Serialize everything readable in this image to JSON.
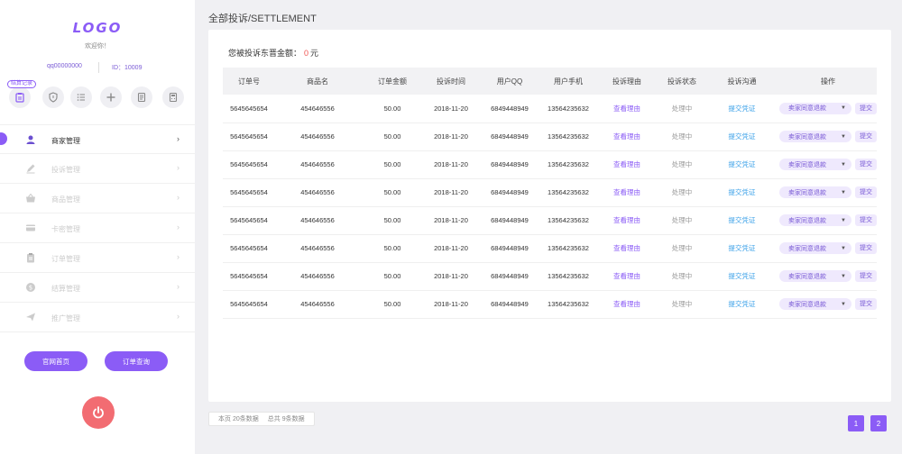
{
  "sidebar": {
    "logo": "LOGO",
    "welcome": "欢迎你！",
    "account_qq": "qq00000000",
    "account_id": "ID：10009",
    "quick_badge": "结算记录",
    "quick_icons": [
      "clipboard-icon",
      "shield-icon",
      "list-icon",
      "plus-icon",
      "document-icon",
      "calculator-icon"
    ],
    "nav": [
      {
        "label": "商家管理",
        "icon": "user-icon",
        "active": true
      },
      {
        "label": "投诉管理",
        "icon": "pencil-icon",
        "active": false
      },
      {
        "label": "商品管理",
        "icon": "basket-icon",
        "active": false
      },
      {
        "label": "卡密管理",
        "icon": "card-icon",
        "active": false
      },
      {
        "label": "订单管理",
        "icon": "clipboard-icon",
        "active": false
      },
      {
        "label": "结算管理",
        "icon": "coin-icon",
        "active": false
      },
      {
        "label": "推广管理",
        "icon": "paper-plane-icon",
        "active": false
      }
    ],
    "home_button": "官网首页",
    "order_query_button": "订单查询"
  },
  "breadcrumb": "全部投诉/SETTLEMENT",
  "summary": {
    "label": "您被投诉东晋金额：",
    "amount": "0",
    "unit": "元"
  },
  "table": {
    "columns": [
      "订单号",
      "商品名",
      "订单金额",
      "投诉时间",
      "用户QQ",
      "用户手机",
      "投诉理由",
      "投诉状态",
      "投诉沟通",
      "操作"
    ],
    "rows": [
      {
        "order_no": "5645645654",
        "product": "454646556",
        "amount": "50.00",
        "time": "2018-11-20",
        "qq": "6849448949",
        "phone": "13564235632",
        "reason": "查看理由",
        "status": "处理中",
        "comm": "提交凭证",
        "action": "卖家同意退款",
        "submit": "提交"
      },
      {
        "order_no": "5645645654",
        "product": "454646556",
        "amount": "50.00",
        "time": "2018-11-20",
        "qq": "6849448949",
        "phone": "13564235632",
        "reason": "查看理由",
        "status": "处理中",
        "comm": "提交凭证",
        "action": "卖家同意退款",
        "submit": "提交"
      },
      {
        "order_no": "5645645654",
        "product": "454646556",
        "amount": "50.00",
        "time": "2018-11-20",
        "qq": "6849448949",
        "phone": "13564235632",
        "reason": "查看理由",
        "status": "处理中",
        "comm": "提交凭证",
        "action": "卖家同意退款",
        "submit": "提交"
      },
      {
        "order_no": "5645645654",
        "product": "454646556",
        "amount": "50.00",
        "time": "2018-11-20",
        "qq": "6849448949",
        "phone": "13564235632",
        "reason": "查看理由",
        "status": "处理中",
        "comm": "提交凭证",
        "action": "卖家同意退款",
        "submit": "提交"
      },
      {
        "order_no": "5645645654",
        "product": "454646556",
        "amount": "50.00",
        "time": "2018-11-20",
        "qq": "6849448949",
        "phone": "13564235632",
        "reason": "查看理由",
        "status": "处理中",
        "comm": "提交凭证",
        "action": "卖家同意退款",
        "submit": "提交"
      },
      {
        "order_no": "5645645654",
        "product": "454646556",
        "amount": "50.00",
        "time": "2018-11-20",
        "qq": "6849448949",
        "phone": "13564235632",
        "reason": "查看理由",
        "status": "处理中",
        "comm": "提交凭证",
        "action": "卖家同意退款",
        "submit": "提交"
      },
      {
        "order_no": "5645645654",
        "product": "454646556",
        "amount": "50.00",
        "time": "2018-11-20",
        "qq": "6849448949",
        "phone": "13564235632",
        "reason": "查看理由",
        "status": "处理中",
        "comm": "提交凭证",
        "action": "卖家同意退款",
        "submit": "提交"
      },
      {
        "order_no": "5645645654",
        "product": "454646556",
        "amount": "50.00",
        "time": "2018-11-20",
        "qq": "6849448949",
        "phone": "13564235632",
        "reason": "查看理由",
        "status": "处理中",
        "comm": "提交凭证",
        "action": "卖家同意退款",
        "submit": "提交"
      }
    ]
  },
  "footer": {
    "page_label": "本页",
    "page_count": "20条数据",
    "total_label": "总共",
    "total_count": "9条数据"
  },
  "pagination": [
    "1",
    "2"
  ],
  "colors": {
    "accent": "#8b5cf6",
    "danger": "#ef5350",
    "link_blue": "#3aa0e8",
    "power": "#f26c72"
  }
}
